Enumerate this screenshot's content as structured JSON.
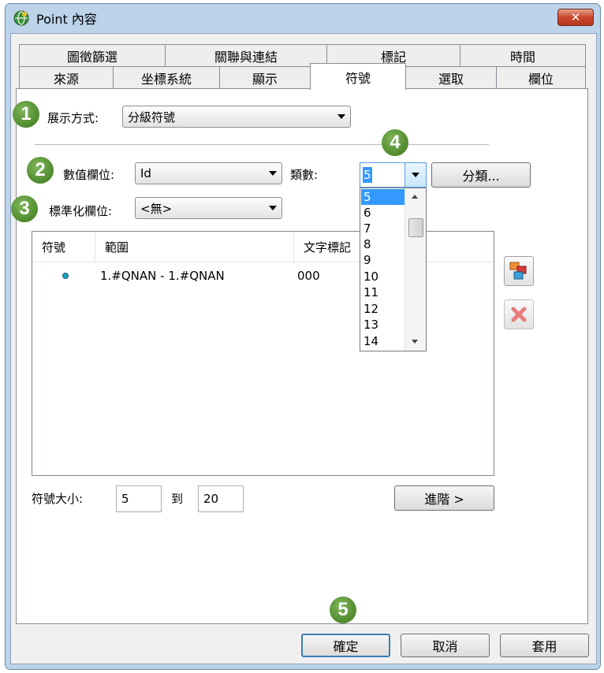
{
  "window": {
    "title": "Point  內容",
    "close_label": "✕"
  },
  "tabs": {
    "row1": [
      "圖徵篩選",
      "關聯與連結",
      "標記",
      "時間"
    ],
    "row2": [
      "來源",
      "坐標系統",
      "顯示",
      "符號",
      "選取",
      "欄位"
    ],
    "active": "符號"
  },
  "markers": [
    "1",
    "2",
    "3",
    "4",
    "5"
  ],
  "display": {
    "label": "展示方式:",
    "value": "分級符號"
  },
  "value_field": {
    "label": "數值欄位:",
    "value": "Id"
  },
  "classes": {
    "label": "類數:",
    "value": "5",
    "classify_label": "分類..."
  },
  "normalize": {
    "label": "標準化欄位:",
    "value": "<無>"
  },
  "dropdown": {
    "options": [
      "5",
      "6",
      "7",
      "8",
      "9",
      "10",
      "11",
      "12",
      "13",
      "14"
    ],
    "selected": "5"
  },
  "table": {
    "headers": [
      "符號",
      "範圍",
      "文字標記"
    ],
    "rows": [
      {
        "symbol_color": "#1aa3c4",
        "range": "1.#QNAN - 1.#QNAN",
        "label": "000"
      }
    ]
  },
  "symbol_size": {
    "label": "符號大小:",
    "from": "5",
    "to_label": "到",
    "to": "20"
  },
  "advanced_label": "進階 >",
  "footer": {
    "ok": "確定",
    "cancel": "取消",
    "apply": "套用"
  }
}
